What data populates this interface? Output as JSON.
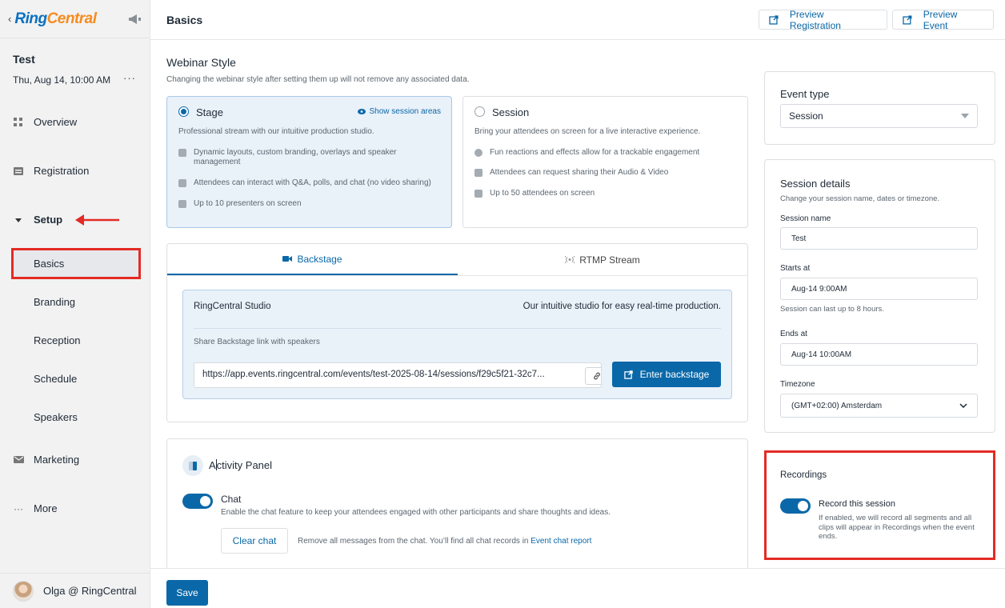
{
  "brand": {
    "ring": "Ring",
    "central": "Central"
  },
  "event": {
    "title": "Test",
    "date": "Thu, Aug 14, 10:00 AM",
    "more": "···"
  },
  "nav": {
    "overview": "Overview",
    "registration": "Registration",
    "setup": "Setup",
    "basics": "Basics",
    "branding": "Branding",
    "reception": "Reception",
    "schedule": "Schedule",
    "speakers": "Speakers",
    "marketing": "Marketing",
    "more": "More"
  },
  "user": {
    "name": "Olga @ RingCentral"
  },
  "header": {
    "title": "Basics",
    "preview_registration": "Preview Registration",
    "preview_event": "Preview Event"
  },
  "webinar": {
    "title": "Webinar Style",
    "subtitle": "Changing the webinar style after setting them up will not remove any associated data.",
    "stage": {
      "name": "Stage",
      "show_areas": "Show session areas",
      "desc": "Professional stream with our intuitive production studio.",
      "features": [
        "Dynamic layouts, custom branding, overlays and speaker management",
        "Attendees can interact with Q&A, polls, and chat (no video sharing)",
        "Up to 10 presenters on screen"
      ]
    },
    "session": {
      "name": "Session",
      "desc": "Bring your attendees on screen for a live interactive experience.",
      "features": [
        "Fun reactions and effects allow for a trackable engagement",
        "Attendees can request sharing their Audio & Video",
        "Up to 50 attendees on screen"
      ]
    }
  },
  "tabs": {
    "backstage": "Backstage",
    "rtmp": "RTMP Stream"
  },
  "studio": {
    "name": "RingCentral Studio",
    "tagline": "Our intuitive studio for easy real-time production.",
    "share_label": "Share Backstage link with speakers",
    "link": "https://app.events.ringcentral.com/events/test-2025-08-14/sessions/f29c5f21-32c7...",
    "enter": "Enter backstage"
  },
  "activity": {
    "title_pre": "A",
    "title_post": "ctivity Panel",
    "chat_label": "Chat",
    "chat_desc": "Enable the chat feature to keep your attendees engaged with other participants and share thoughts and ideas.",
    "clear_chat": "Clear chat",
    "clear_desc": "Remove all messages from the chat. You’ll find all chat records in",
    "report_link": "Event chat report"
  },
  "event_type": {
    "title": "Event type",
    "value": "Session"
  },
  "session_details": {
    "title": "Session details",
    "subtitle": "Change your session name, dates or timezone.",
    "name_label": "Session name",
    "name_value": "Test",
    "starts_label": "Starts at",
    "starts_value": "Aug-14 9:00AM",
    "starts_hint": "Session can last up to 8 hours.",
    "ends_label": "Ends at",
    "ends_value": "Aug-14 10:00AM",
    "tz_label": "Timezone",
    "tz_value": "(GMT+02:00) Amsterdam"
  },
  "recordings": {
    "title": "Recordings",
    "toggle_label": "Record this session",
    "desc": "If enabled, we will record all segments and all clips will appear in Recordings when the event ends."
  },
  "footer": {
    "save": "Save"
  },
  "colors": {
    "accent": "#0a68a8",
    "highlight": "#e32b24",
    "brand_blue": "#0a70c0",
    "brand_orange": "#f68b1f"
  }
}
